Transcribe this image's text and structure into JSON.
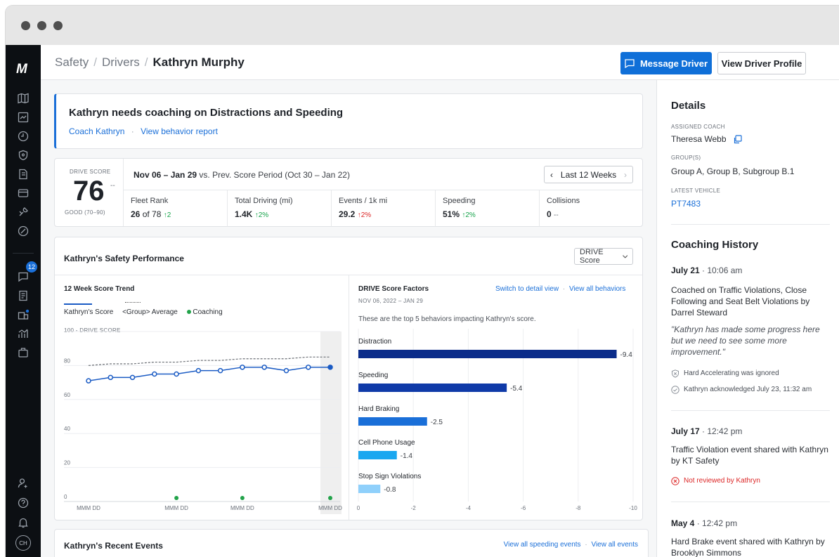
{
  "sidebar": {
    "logo": "M",
    "badge_count": "12",
    "avatar_initials": "CH"
  },
  "breadcrumb": {
    "level1": "Safety",
    "level2": "Drivers",
    "current": "Kathryn Murphy"
  },
  "header": {
    "message_button": "Message Driver",
    "profile_button": "View Driver Profile"
  },
  "alert": {
    "title": "Kathryn needs coaching on Distractions and Speeding",
    "coach_link": "Coach Kathryn",
    "sep": "·",
    "report_link": "View behavior report"
  },
  "score": {
    "label": "DRIVE SCORE",
    "value": "76",
    "delta": "--",
    "rating": "GOOD (70–90)",
    "period": "Nov 06 – Jan 29",
    "vs_text": "vs. Prev. Score Period (Oct 30 – Jan 22)",
    "range_label": "Last 12 Weeks",
    "metrics": [
      {
        "title": "Fleet Rank",
        "value": "26",
        "suffix": "of 78",
        "change": "↑2",
        "trend": "up"
      },
      {
        "title": "Total Driving (mi)",
        "value": "1.4K",
        "suffix": "",
        "change": "↑2%",
        "trend": "up"
      },
      {
        "title": "Events / 1k mi",
        "value": "29.2",
        "suffix": "",
        "change": "↑2%",
        "trend": "bad"
      },
      {
        "title": "Speeding",
        "value": "51%",
        "suffix": "",
        "change": "↑2%",
        "trend": "up"
      },
      {
        "title": "Collisions",
        "value": "0",
        "suffix": "",
        "change": "--",
        "trend": "none"
      }
    ]
  },
  "performance": {
    "title": "Kathryn's Safety Performance",
    "dropdown": "DRIVE Score"
  },
  "trend": {
    "title": "12 Week Score Trend",
    "legend_score": "Kathryn's Score",
    "legend_avg": "<Group> Average",
    "legend_coaching": "Coaching",
    "y_caption": "100 - DRIVE SCORE",
    "y_ticks": [
      "80",
      "60",
      "40",
      "20",
      "0"
    ],
    "x_ticks": [
      "MMM DD",
      "MMM DD",
      "MMM DD",
      "MMM DD"
    ]
  },
  "factors": {
    "title": "DRIVE Score Factors",
    "date": "NOV 06, 2022 – JAN 29",
    "switch_link": "Switch to detail view",
    "sep": "·",
    "all_link": "View all behaviors",
    "description": "These are the top 5 behaviors impacting Kathryn's score.",
    "x_ticks": [
      "0",
      "-2",
      "-4",
      "-6",
      "-8",
      "-10"
    ]
  },
  "chart_data": [
    {
      "type": "line",
      "title": "12 Week Score Trend",
      "ylabel": "100 - DRIVE SCORE",
      "ylim": [
        0,
        100
      ],
      "x": [
        1,
        2,
        3,
        4,
        5,
        6,
        7,
        8,
        9,
        10,
        11,
        12
      ],
      "x_tick_labels": [
        "MMM DD",
        "MMM DD",
        "MMM DD",
        "MMM DD"
      ],
      "series": [
        {
          "name": "Kathryn's Score",
          "values": [
            71,
            73,
            73,
            75,
            75,
            77,
            77,
            79,
            79,
            77,
            79,
            79
          ],
          "color": "#1a5bc4"
        },
        {
          "name": "<Group> Average",
          "values": [
            80,
            81,
            81,
            82,
            82,
            83,
            83,
            84,
            84,
            84,
            85,
            85
          ],
          "color": "#6b6f75"
        }
      ],
      "coaching_weeks": [
        5,
        8,
        12
      ],
      "grid": true
    },
    {
      "type": "bar",
      "title": "DRIVE Score Factors",
      "orientation": "horizontal",
      "categories": [
        "Distraction",
        "Speeding",
        "Hard Braking",
        "Cell Phone Usage",
        "Stop Sign Violations"
      ],
      "values": [
        -9.4,
        -5.4,
        -2.5,
        -1.4,
        -0.8
      ],
      "value_labels": [
        "-9.4",
        "-5.4",
        "-2.5",
        "-1.4",
        "-0.8"
      ],
      "colors": [
        "#0b2c8a",
        "#0f3aa8",
        "#1a6fd8",
        "#1aa7f0",
        "#8fd0fb"
      ],
      "xlim": [
        0,
        -10
      ]
    }
  ],
  "events": {
    "title": "Kathryn's Recent Events",
    "speeding_link": "View all speeding events",
    "sep": "·",
    "all_link": "View all events"
  },
  "details": {
    "title": "Details",
    "coach_label": "ASSIGNED COACH",
    "coach": "Theresa Webb",
    "groups_label": "GROUP(S)",
    "groups": "Group A, Group B, Subgroup B.1",
    "vehicle_label": "LATEST VEHICLE",
    "vehicle": "PT7483"
  },
  "history": {
    "title": "Coaching History",
    "entries": [
      {
        "date": "July 21",
        "time": "· 10:06 am",
        "text": "Coached on Traffic Violations, Close Following and Seat Belt Violations by Darrel Steward",
        "quote": "\"Kathryn has made some progress here but we need to see some more improvement.\"",
        "note1": "Hard Accelerating was ignored",
        "note2": "Kathryn acknowledged July 23, 11:32 am"
      },
      {
        "date": "July 17",
        "time": "· 12:42 pm",
        "text": "Traffic Violation event shared with Kathryn by KT Safety",
        "status": "Not reviewed by Kathryn"
      },
      {
        "date": "May 4",
        "time": "· 12:42 pm",
        "text": "Hard Brake event shared with Kathryn by Brooklyn Simmons"
      }
    ]
  }
}
